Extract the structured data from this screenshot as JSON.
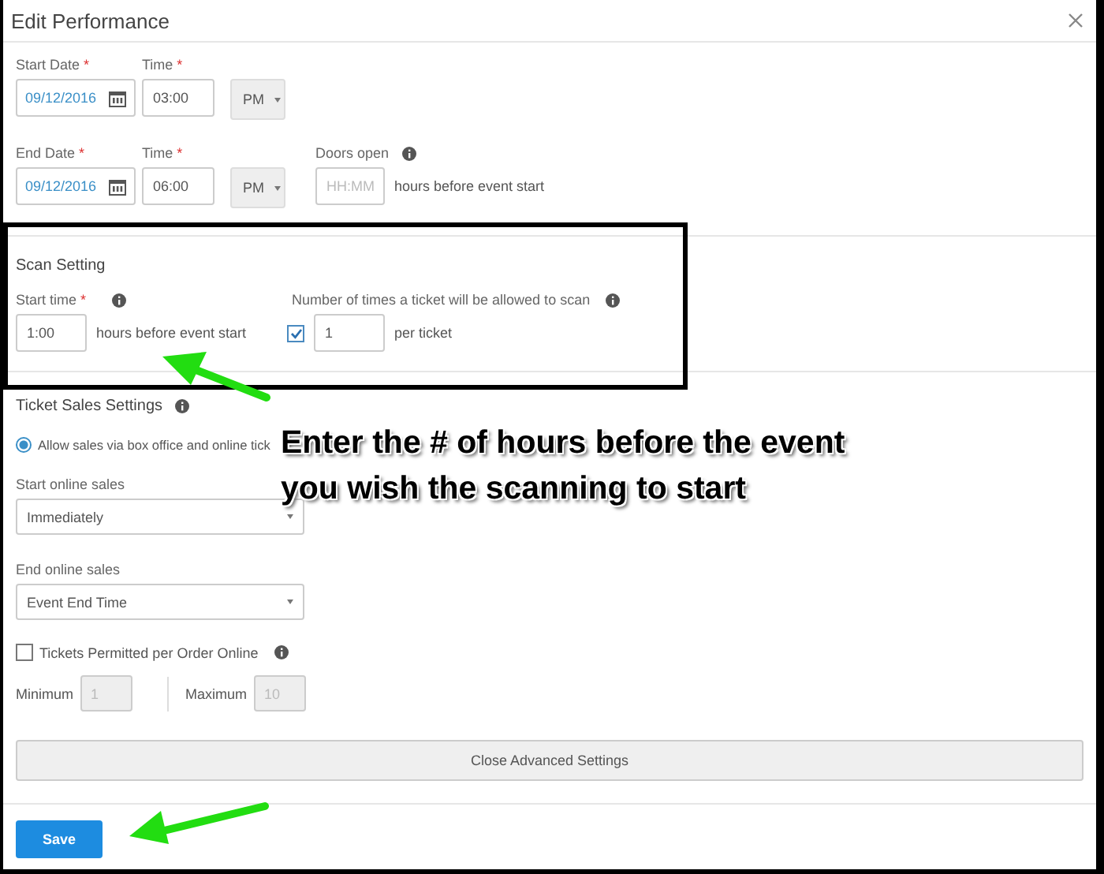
{
  "dialog": {
    "title": "Edit Performance"
  },
  "schedule": [
    {
      "date_label": {
        "text": "Start Date",
        "mark": "*"
      },
      "date": "09/12/2016",
      "time_label": {
        "text": "Time",
        "mark": "*"
      },
      "time": "03:00",
      "meridiem": "PM"
    },
    {
      "date_label": {
        "text": "End Date",
        "mark": "*"
      },
      "date": "09/12/2016",
      "time_label": {
        "text": "Time",
        "mark": "*"
      },
      "time": "06:00",
      "meridiem": "PM",
      "doors_open": {
        "label": "Doors open",
        "placeholder": "HH:MM",
        "suffix": "hours before event start"
      }
    }
  ],
  "scan_setting": {
    "title": "Scan Setting",
    "start_time": {
      "label": {
        "text": "Start time",
        "mark": "*"
      },
      "value": "1:00",
      "suffix": "hours before event start"
    },
    "scan_limit": {
      "label": "Number of times a ticket will be allowed to scan",
      "checked": true,
      "value": "1",
      "suffix": "per ticket"
    }
  },
  "ticket_sales": {
    "title": "Ticket Sales Settings",
    "options": [
      {
        "label": "Allow sales via box office and online tick",
        "selected": true
      }
    ],
    "start_online_sales": {
      "label": "Start online sales",
      "value": "Immediately"
    },
    "end_online_sales": {
      "label": "End online sales",
      "value": "Event End Time"
    },
    "per_order_limit": {
      "label": "Tickets Permitted per Order Online",
      "checked": false,
      "minimum": {
        "label": "Minimum",
        "value": "1",
        "disabled": true
      },
      "maximum": {
        "label": "Maximum",
        "value": "10",
        "disabled": true
      }
    }
  },
  "advanced_button": "Close Advanced Settings",
  "save_button": "Save",
  "annotation": {
    "callout": "Enter the # of hours before the event\nyou wish the scanning to start"
  }
}
